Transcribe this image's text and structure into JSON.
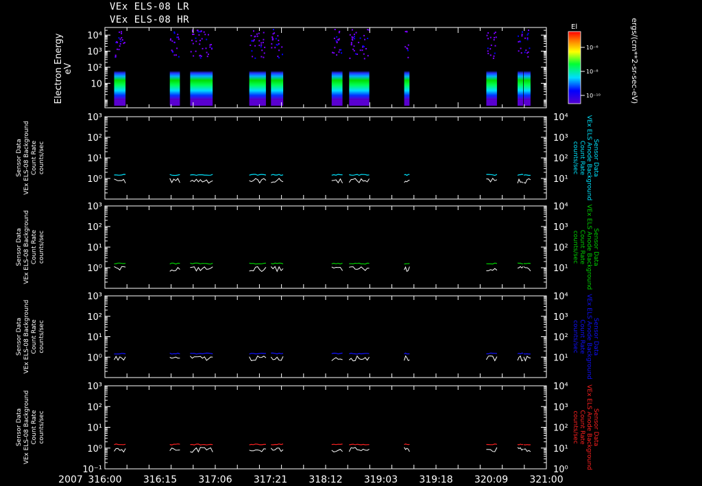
{
  "titles": [
    "VEx ELS-08 LR",
    "VEx ELS-08 HR"
  ],
  "year_label": "2007",
  "colors": {
    "cyan": "#00e5ff",
    "green": "#00d000",
    "blue": "#1010ff",
    "red": "#ff2020",
    "white": "#ffffff"
  },
  "chart_data": [
    {
      "type": "heatmap",
      "ylabel": [
        "Electron Energy",
        "eV"
      ],
      "ytick_labels": [
        "10",
        "10²",
        "10³",
        "10⁴"
      ],
      "ylim": [
        0.3,
        30000
      ],
      "yscale": "log",
      "colorbar": {
        "title": "El",
        "tick_labels": [
          "10⁻⁶",
          "10⁻⁸",
          "10⁻¹⁰"
        ],
        "unit_label": "ergs/(cm**2-sr-sec-eV)"
      },
      "x_tick_labels": [
        "316:00",
        "316:15",
        "317:06",
        "317:21",
        "318:12",
        "319:03",
        "319:18",
        "320:09",
        "321:00"
      ],
      "data_intervals": [
        [
          0.035,
          0.078
        ],
        [
          0.245,
          0.283
        ],
        [
          0.322,
          0.407
        ],
        [
          0.545,
          0.608
        ],
        [
          0.627,
          0.673
        ],
        [
          0.856,
          0.897
        ],
        [
          0.922,
          0.998
        ],
        [
          1.13,
          1.15
        ],
        [
          1.44,
          1.48
        ],
        [
          1.558,
          1.579
        ],
        [
          1.581,
          1.607
        ]
      ]
    },
    {
      "type": "line",
      "ylabel": [
        "Sensor Data",
        "VEx ELS-08 Background",
        "Count Rate",
        "counts/sec"
      ],
      "right_label": [
        "Sensor Data",
        "VEx ELS Anode Background",
        "Count Rate",
        "counts/sec"
      ],
      "right_color": "cyan",
      "ylim": [
        0.1,
        1000
      ],
      "yscale": "log",
      "left_tick_labels": [
        "10⁰",
        "10¹",
        "10²",
        "10³"
      ],
      "right_tick_labels": [
        "10¹",
        "10²",
        "10³",
        "10⁴"
      ],
      "series": [
        {
          "name": "Anode Background",
          "color": "cyan",
          "level": 1.5
        },
        {
          "name": "",
          "color": "white",
          "level": 0.8
        }
      ]
    },
    {
      "type": "line",
      "ylabel": [
        "Sensor Data",
        "VEx ELS-08 Background",
        "Count Rate",
        "counts/sec"
      ],
      "right_label": [
        "Sensor Data",
        "VEx ELS Anode Background",
        "Count Rate",
        "counts/sec"
      ],
      "right_color": "green",
      "ylim": [
        0.1,
        1000
      ],
      "yscale": "log",
      "left_tick_labels": [
        "10⁰",
        "10¹",
        "10²",
        "10³"
      ],
      "right_tick_labels": [
        "10¹",
        "10²",
        "10³",
        "10⁴"
      ],
      "series": [
        {
          "name": "Anode Background",
          "color": "green",
          "level": 1.6
        },
        {
          "name": "",
          "color": "white",
          "level": 0.9
        }
      ]
    },
    {
      "type": "line",
      "ylabel": [
        "Sensor Data",
        "VEx ELS-08 Background",
        "Count Rate",
        "counts/sec"
      ],
      "right_label": [
        "Sensor Data",
        "VEx ELS Anode Background",
        "Count Rate",
        "counts/sec"
      ],
      "right_color": "blue",
      "ylim": [
        0.1,
        1000
      ],
      "yscale": "log",
      "left_tick_labels": [
        "10⁰",
        "10¹",
        "10²",
        "10³"
      ],
      "right_tick_labels": [
        "10¹",
        "10²",
        "10³",
        "10⁴"
      ],
      "series": [
        {
          "name": "Anode Background",
          "color": "blue",
          "level": 1.5
        },
        {
          "name": "",
          "color": "white",
          "level": 0.9
        }
      ]
    },
    {
      "type": "line",
      "ylabel": [
        "Sensor Data",
        "VEx ELS-08 Background",
        "Count Rate",
        "counts/sec"
      ],
      "right_label": [
        "Sensor Data",
        "VEx ELS Anode Background",
        "Count Rate",
        "counts/sec"
      ],
      "right_color": "red",
      "ylim": [
        0.1,
        1000
      ],
      "yscale": "log",
      "left_tick_labels": [
        "10⁻¹",
        "10⁰",
        "10¹",
        "10²",
        "10³"
      ],
      "right_tick_labels": [
        "10⁰",
        "10¹",
        "10²",
        "10³",
        "10⁴"
      ],
      "series": [
        {
          "name": "Anode Background",
          "color": "red",
          "level": 1.5
        },
        {
          "name": "",
          "color": "white",
          "level": 0.85
        }
      ]
    }
  ]
}
